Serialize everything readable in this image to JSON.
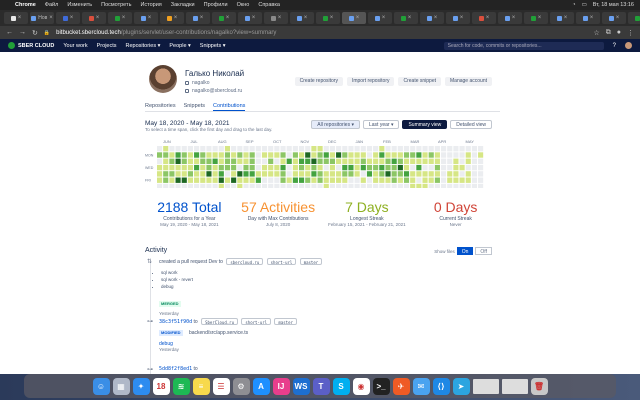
{
  "menubar": {
    "apple": "",
    "items": [
      "Chrome",
      "Файл",
      "Изменить",
      "Посмотреть",
      "История",
      "Закладки",
      "Профили",
      "Окно",
      "Справка"
    ],
    "clock": "Вт, 18 мая 13:16"
  },
  "tabs": [
    {
      "label": "",
      "active": false
    },
    {
      "label": "Нов",
      "active": false
    },
    {
      "label": "",
      "active": false
    },
    {
      "label": "",
      "active": false
    },
    {
      "label": "",
      "active": false
    },
    {
      "label": "",
      "active": false
    },
    {
      "label": "",
      "active": false
    },
    {
      "label": "",
      "active": false
    },
    {
      "label": "",
      "active": false
    },
    {
      "label": "",
      "active": false
    },
    {
      "label": "",
      "active": false
    },
    {
      "label": "",
      "active": false
    },
    {
      "label": "",
      "active": false
    },
    {
      "label": "",
      "active": true
    },
    {
      "label": "",
      "active": false
    },
    {
      "label": "",
      "active": false
    },
    {
      "label": "",
      "active": false
    },
    {
      "label": "",
      "active": false
    },
    {
      "label": "",
      "active": false
    },
    {
      "label": "",
      "active": false
    },
    {
      "label": "",
      "active": false
    },
    {
      "label": "",
      "active": false
    },
    {
      "label": "",
      "active": false
    },
    {
      "label": "",
      "active": false
    },
    {
      "label": "",
      "active": false
    }
  ],
  "url": {
    "host": "bitbucket.sbercloud.tech",
    "path": "/plugins/servlet/user-contributions/nagalko?view=summary"
  },
  "appbar": {
    "logo": "SBER CLOUD",
    "nav": [
      "Your work",
      "Projects",
      "Repositories ▾",
      "People ▾",
      "Snippets ▾"
    ],
    "search": "Search for code, commits or repositories..."
  },
  "profile": {
    "name": "Галько Николай",
    "username": "nagalko",
    "email": "nagalko@sbercloud.ru",
    "buttons": [
      "Create repository",
      "Import repository",
      "Create snippet",
      "Manage account"
    ]
  },
  "subtabs": [
    "Repositories",
    "Snippets",
    "Contributions"
  ],
  "contrib": {
    "range": "May 18, 2020 - May 18, 2021",
    "hint": "To select a time span, click the first day and drag to the last day.",
    "repo_select": "All repositories ▾",
    "period_select": "Last year ▾",
    "summary": "Summary view",
    "detailed": "Detailed view",
    "months": [
      "JUN",
      "JUL",
      "AUG",
      "SEP",
      "OCT",
      "NOV",
      "DEC",
      "JAN",
      "FEB",
      "MAR",
      "APR",
      "MAY"
    ],
    "days": [
      "MON",
      "WED",
      "FRI"
    ]
  },
  "chart_data": {
    "type": "heatmap",
    "rows": 7,
    "weeks": 53,
    "palette": [
      "#ebedf0",
      "#d6e685",
      "#8cc665",
      "#44a340",
      "#1e6823"
    ]
  },
  "stats": [
    {
      "value": "2188 Total",
      "label": "Contributions for a Year",
      "detail": "May 19, 2020 - May 18, 2021",
      "color": "#0052cc"
    },
    {
      "value": "57 Activities",
      "label": "Day with Max Contributions",
      "detail": "July 8, 2020",
      "color": "#f79232"
    },
    {
      "value": "7 Days",
      "label": "Longest Streak",
      "detail": "February 15, 2021 - February 21, 2021",
      "color": "#8eb021"
    },
    {
      "value": "0 Days",
      "label": "Current Streak",
      "detail": "Never",
      "color": "#d04437"
    }
  ],
  "activity": {
    "title": "Activity",
    "show_files": "Show files",
    "on": "On",
    "off": "Off",
    "items": [
      {
        "text": "created a pull request Dev to",
        "repo": "sbercloud.ru",
        "repo2": "short-url",
        "branch": "master",
        "messages": [
          "sql work",
          "sql work - revert",
          "debug"
        ],
        "status": "MERGED",
        "time": "Yesterday"
      },
      {
        "hash": "38c3f51f90d",
        "to": "to",
        "repo": "SberCloud.ru",
        "repo2": "short-url",
        "branch": "master",
        "status": "MODIFIED",
        "file": "backend/src/app.service.ts",
        "message": "debug",
        "time": "Yesterday"
      },
      {
        "hash": "5dd8f2f8ed1",
        "to": "to"
      }
    ]
  },
  "dock": [
    {
      "name": "finder",
      "color": "#3a8ee6",
      "glyph": "☺"
    },
    {
      "name": "launchpad",
      "color": "#b0b8c8",
      "glyph": "▦"
    },
    {
      "name": "safari",
      "color": "#2d8cf0",
      "glyph": "✦"
    },
    {
      "name": "calendar",
      "color": "#ffffff",
      "glyph": "18"
    },
    {
      "name": "spotify",
      "color": "#1db954",
      "glyph": "≋"
    },
    {
      "name": "notes",
      "color": "#f7d94c",
      "glyph": "≡"
    },
    {
      "name": "reminders",
      "color": "#ffffff",
      "glyph": "☰"
    },
    {
      "name": "settings",
      "color": "#8e8e93",
      "glyph": "⚙"
    },
    {
      "name": "app-store",
      "color": "#1e90ff",
      "glyph": "A"
    },
    {
      "name": "intellij",
      "color": "#e83e8c",
      "glyph": "IJ"
    },
    {
      "name": "webstorm",
      "color": "#1d6fd1",
      "glyph": "WS"
    },
    {
      "name": "teams",
      "color": "#5b5fc7",
      "glyph": "T"
    },
    {
      "name": "skype",
      "color": "#00aff0",
      "glyph": "S"
    },
    {
      "name": "chrome",
      "color": "#ffffff",
      "glyph": "◉"
    },
    {
      "name": "terminal",
      "color": "#222222",
      "glyph": ">_"
    },
    {
      "name": "postman",
      "color": "#ef5b25",
      "glyph": "✈"
    },
    {
      "name": "mail",
      "color": "#4aa3f0",
      "glyph": "✉"
    },
    {
      "name": "vscode",
      "color": "#1e88e5",
      "glyph": "⟨⟩"
    },
    {
      "name": "telegram",
      "color": "#2ca5e0",
      "glyph": "➤"
    },
    {
      "name": "trash",
      "color": "#c8c8c8",
      "glyph": "🗑"
    }
  ]
}
